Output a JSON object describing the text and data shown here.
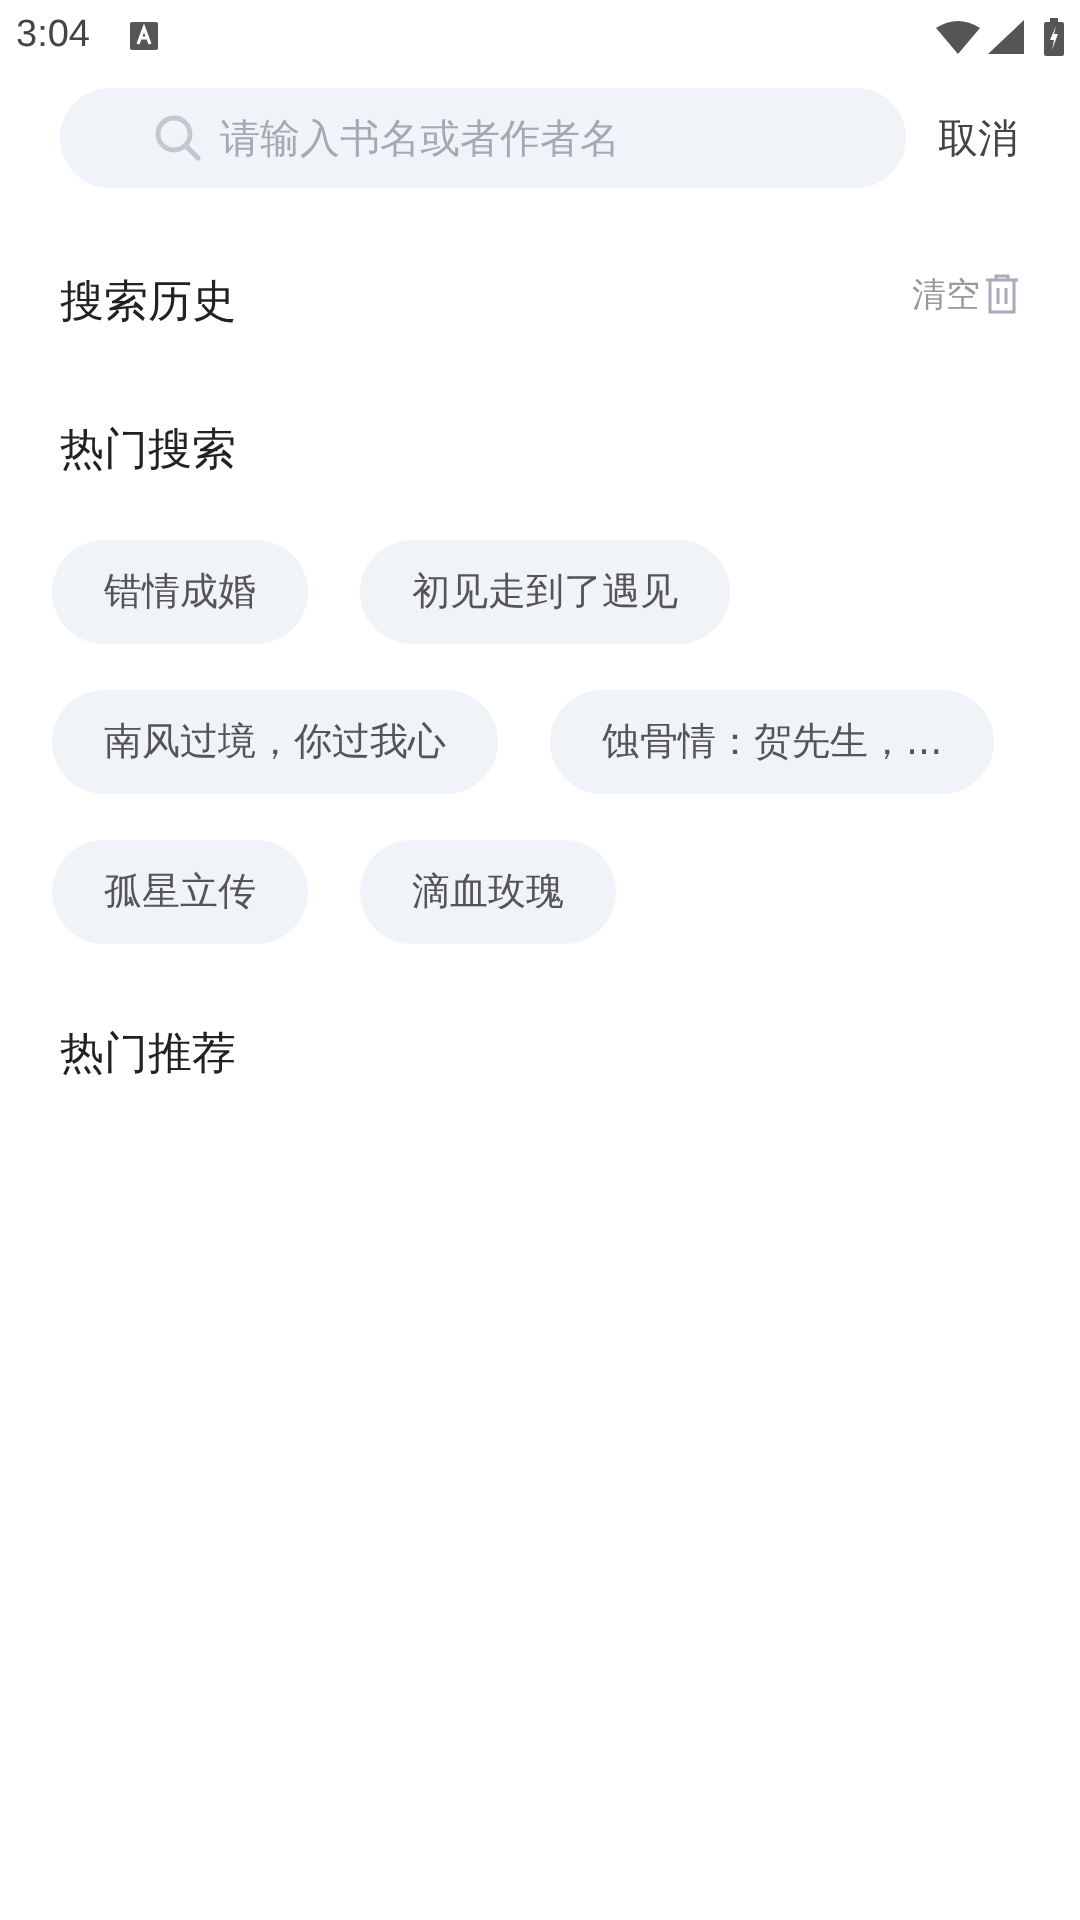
{
  "status_bar": {
    "time": "3:04"
  },
  "search": {
    "placeholder": "请输入书名或者作者名",
    "cancel": "取消"
  },
  "history": {
    "title": "搜索历史",
    "clear": "清空"
  },
  "hot_search": {
    "title": "热门搜索",
    "tags": [
      {
        "label": "错情成婚"
      },
      {
        "label": "初见走到了遇见"
      },
      {
        "label": "南风过境，你过我心"
      },
      {
        "label": "蚀骨情：贺先生，..."
      },
      {
        "label": "孤星立传"
      },
      {
        "label": "滴血玫瑰"
      }
    ]
  },
  "recommend": {
    "title": "热门推荐"
  }
}
